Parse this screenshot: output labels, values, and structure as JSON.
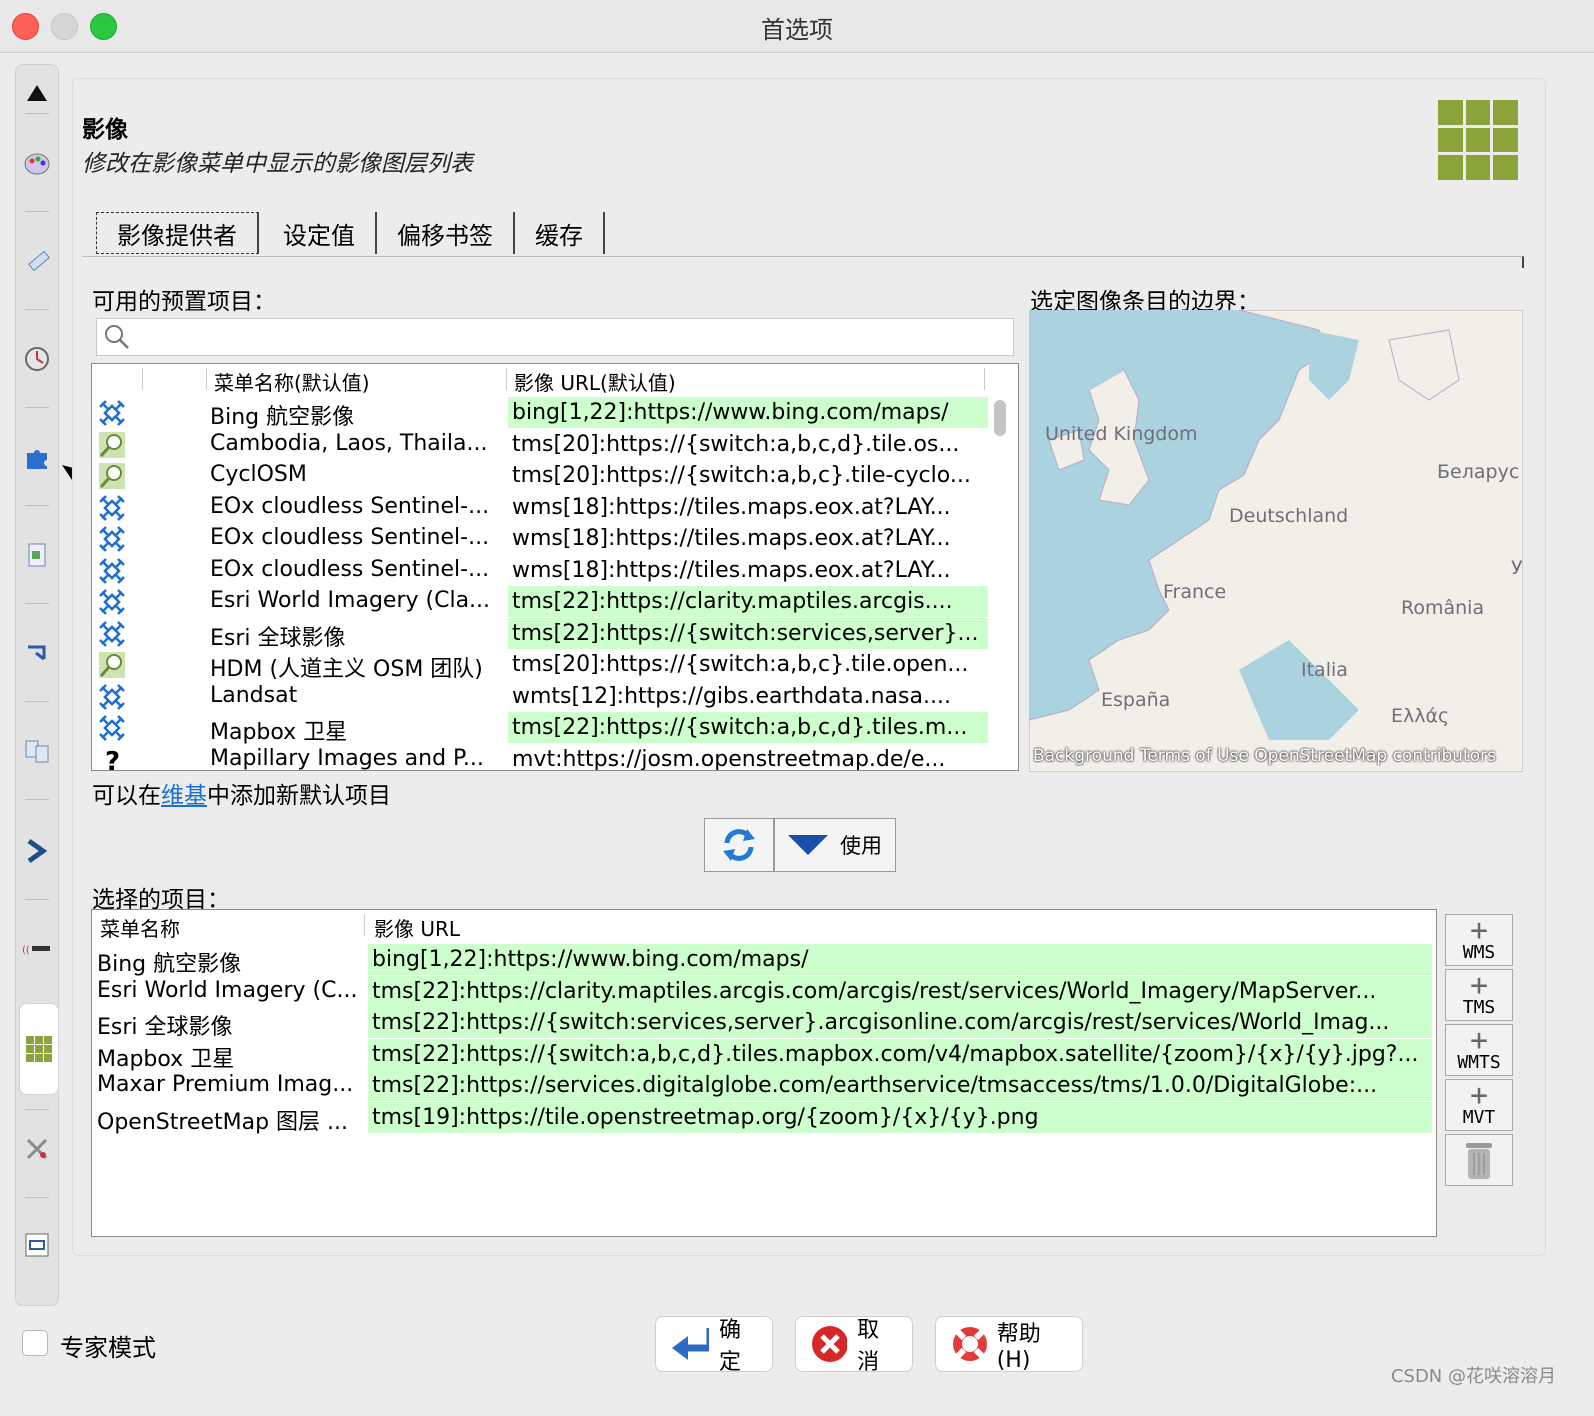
{
  "window": {
    "title": "首选项"
  },
  "section": {
    "title": "影像",
    "subtitle": "修改在影像菜单中显示的影像图层列表"
  },
  "tabs": [
    {
      "label": "影像提供者",
      "active": true
    },
    {
      "label": "设定值"
    },
    {
      "label": "偏移书签"
    },
    {
      "label": "缓存"
    }
  ],
  "available": {
    "label": "可用的预置项目：",
    "search_placeholder": "",
    "columns": [
      "菜单名称(默认值)",
      "影像 URL(默认值)"
    ],
    "rows": [
      {
        "icon": "satellite-icon",
        "name": "Bing 航空影像",
        "url": "bing[1,22]:https://www.bing.com/maps/",
        "selected": true
      },
      {
        "icon": "magnifier-map-icon",
        "name": "Cambodia, Laos, Thaila...",
        "url": "tms[20]:https://{switch:a,b,c,d}.tile.os...",
        "selected": false
      },
      {
        "icon": "magnifier-map-icon",
        "name": "CyclOSM",
        "url": "tms[20]:https://{switch:a,b,c}.tile-cyclo...",
        "selected": false
      },
      {
        "icon": "satellite-icon",
        "name": "EOx cloudless Sentinel-...",
        "url": "wms[18]:https://tiles.maps.eox.at?LAY...",
        "selected": false
      },
      {
        "icon": "satellite-icon",
        "name": "EOx cloudless Sentinel-...",
        "url": "wms[18]:https://tiles.maps.eox.at?LAY...",
        "selected": false
      },
      {
        "icon": "satellite-icon",
        "name": "EOx cloudless Sentinel-...",
        "url": "wms[18]:https://tiles.maps.eox.at?LAY...",
        "selected": false
      },
      {
        "icon": "satellite-icon",
        "name": "Esri World Imagery (Cla...",
        "url": "tms[22]:https://clarity.maptiles.arcgis....",
        "selected": true
      },
      {
        "icon": "satellite-icon",
        "name": "Esri 全球影像",
        "url": "tms[22]:https://{switch:services,server}...",
        "selected": true
      },
      {
        "icon": "magnifier-map-icon",
        "name": "HDM (人道主义 OSM 团队)",
        "url": "tms[20]:https://{switch:a,b,c}.tile.open...",
        "selected": false
      },
      {
        "icon": "satellite-icon",
        "name": "Landsat",
        "url": "wmts[12]:https://gibs.earthdata.nasa....",
        "selected": false
      },
      {
        "icon": "satellite-icon",
        "name": "Mapbox 卫星",
        "url": "tms[22]:https://{switch:a,b,c,d}.tiles.m...",
        "selected": true
      },
      {
        "icon": "question-icon",
        "name": "Mapillary Images and P...",
        "url": "mvt:https://josm.openstreetmap.de/e...",
        "selected": false
      }
    ]
  },
  "bounds": {
    "label": "选定图像条目的边界：",
    "map_labels": [
      "United Kingdom",
      "Беларус",
      "Deutschland",
      "France",
      "România",
      "Italia",
      "España",
      "Ελλάς",
      "У"
    ],
    "attribution": "Background Terms of Use OpenStreetMap contributors"
  },
  "wiki": {
    "prefix": "可以在",
    "link": "维基",
    "suffix": "中添加新默认项目"
  },
  "actions": {
    "use_label": "使用"
  },
  "selected": {
    "label": "选择的项目：",
    "columns": [
      "菜单名称",
      "影像 URL"
    ],
    "rows": [
      {
        "name": "Bing 航空影像",
        "url": "bing[1,22]:https://www.bing.com/maps/"
      },
      {
        "name": "Esri World Imagery (C...",
        "url": "tms[22]:https://clarity.maptiles.arcgis.com/arcgis/rest/services/World_Imagery/MapServer..."
      },
      {
        "name": "Esri 全球影像",
        "url": "tms[22]:https://{switch:services,server}.arcgisonline.com/arcgis/rest/services/World_Imag..."
      },
      {
        "name": "Mapbox 卫星",
        "url": "tms[22]:https://{switch:a,b,c,d}.tiles.mapbox.com/v4/mapbox.satellite/{zoom}/{x}/{y}.jpg?..."
      },
      {
        "name": "Maxar Premium Imag...",
        "url": "tms[22]:https://services.digitalglobe.com/earthservice/tmsaccess/tms/1.0.0/DigitalGlobe:..."
      },
      {
        "name": "OpenStreetMap 图层 ...",
        "url": "tms[19]:https://tile.openstreetmap.org/{zoom}/{x}/{y}.png"
      }
    ]
  },
  "add_buttons": [
    "WMS",
    "TMS",
    "WMTS",
    "MVT"
  ],
  "expert_mode": {
    "label": "专家模式",
    "checked": false
  },
  "footer": {
    "ok": "确定",
    "cancel": "取消",
    "help": "帮助(H)"
  },
  "watermark": "CSDN @花咲溶溶月",
  "colors": {
    "selected_row": "#ccffcc",
    "accent_link": "#1a6fd6",
    "logo": "#8aa33a"
  }
}
